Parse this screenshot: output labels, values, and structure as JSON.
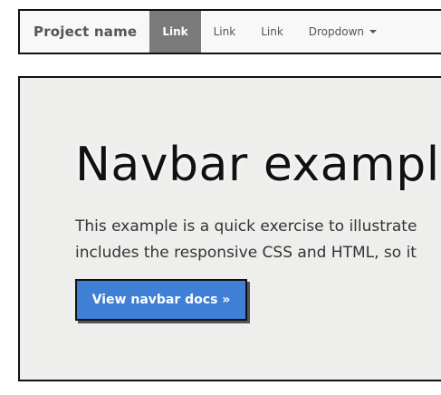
{
  "navbar": {
    "brand": "Project name",
    "links": [
      {
        "label": "Link",
        "active": true
      },
      {
        "label": "Link",
        "active": false
      },
      {
        "label": "Link",
        "active": false
      }
    ],
    "dropdown_label": "Dropdown"
  },
  "jumbotron": {
    "heading": "Navbar exampl",
    "lead_lines": [
      "This example is a quick exercise to illustrate",
      "includes the responsive CSS and HTML, so it"
    ],
    "button_label": "View navbar docs »"
  },
  "colors": {
    "active_link_bg": "#7a7a7a",
    "button_bg": "#3f7fd6",
    "jumbotron_bg": "#eeeeec"
  }
}
